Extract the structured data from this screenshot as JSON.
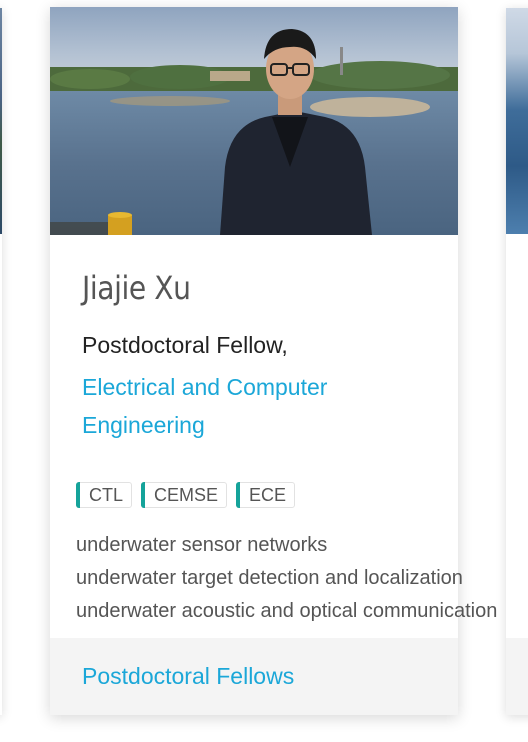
{
  "card": {
    "name": "Jiajie Xu",
    "role": "Postdoctoral Fellow,",
    "department": "Electrical and Computer Engineering",
    "tags": [
      "CTL",
      "CEMSE",
      "ECE"
    ],
    "interests": [
      "underwater sensor networks",
      "underwater target detection and localization",
      "underwater acoustic and optical communication"
    ],
    "footer_link": "Postdoctoral Fellows",
    "photo_icon": "profile-photo",
    "accent_color": "#1ba7d8",
    "tag_accent_color": "#15a39a"
  }
}
